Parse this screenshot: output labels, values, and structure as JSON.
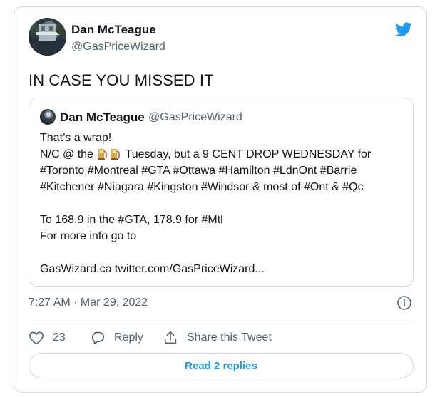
{
  "tweet": {
    "author_name": "Dan McTeague",
    "author_handle": "@GasPriceWizard",
    "text": "IN CASE YOU MISSED IT",
    "timestamp": "7:27 AM · Mar 29, 2022"
  },
  "quoted_tweet": {
    "author_name": "Dan McTeague",
    "author_handle": "@GasPriceWizard",
    "line1": "That’s a wrap!",
    "line2_before": "N/C @ the",
    "line2_after": "Tuesday, but a 9 CENT DROP WEDNESDAY for",
    "line3": "#Toronto #Montreal #GTA #Ottawa #Hamilton #LdnOnt #Barrie",
    "line4": "#Kitchener #Niagara #Kingston #Windsor & most of #Ont & #Qc",
    "line5": "To 168.9 in the #GTA, 178.9 for #Mtl",
    "line6": "For more info go to",
    "line7": "GasWizard.ca twitter.com/GasPriceWizard..."
  },
  "actions": {
    "like_count": "23",
    "reply_label": "Reply",
    "share_label": "Share this Tweet"
  },
  "read_replies_label": "Read 2 replies",
  "colors": {
    "twitter_blue": "#1d9bf0",
    "text_primary": "#0f1419",
    "text_secondary": "#536471",
    "border": "#cfd9de"
  },
  "icons": [
    "twitter-bird-icon",
    "fuel-pump-icon",
    "info-icon",
    "heart-icon",
    "reply-icon",
    "share-icon"
  ]
}
